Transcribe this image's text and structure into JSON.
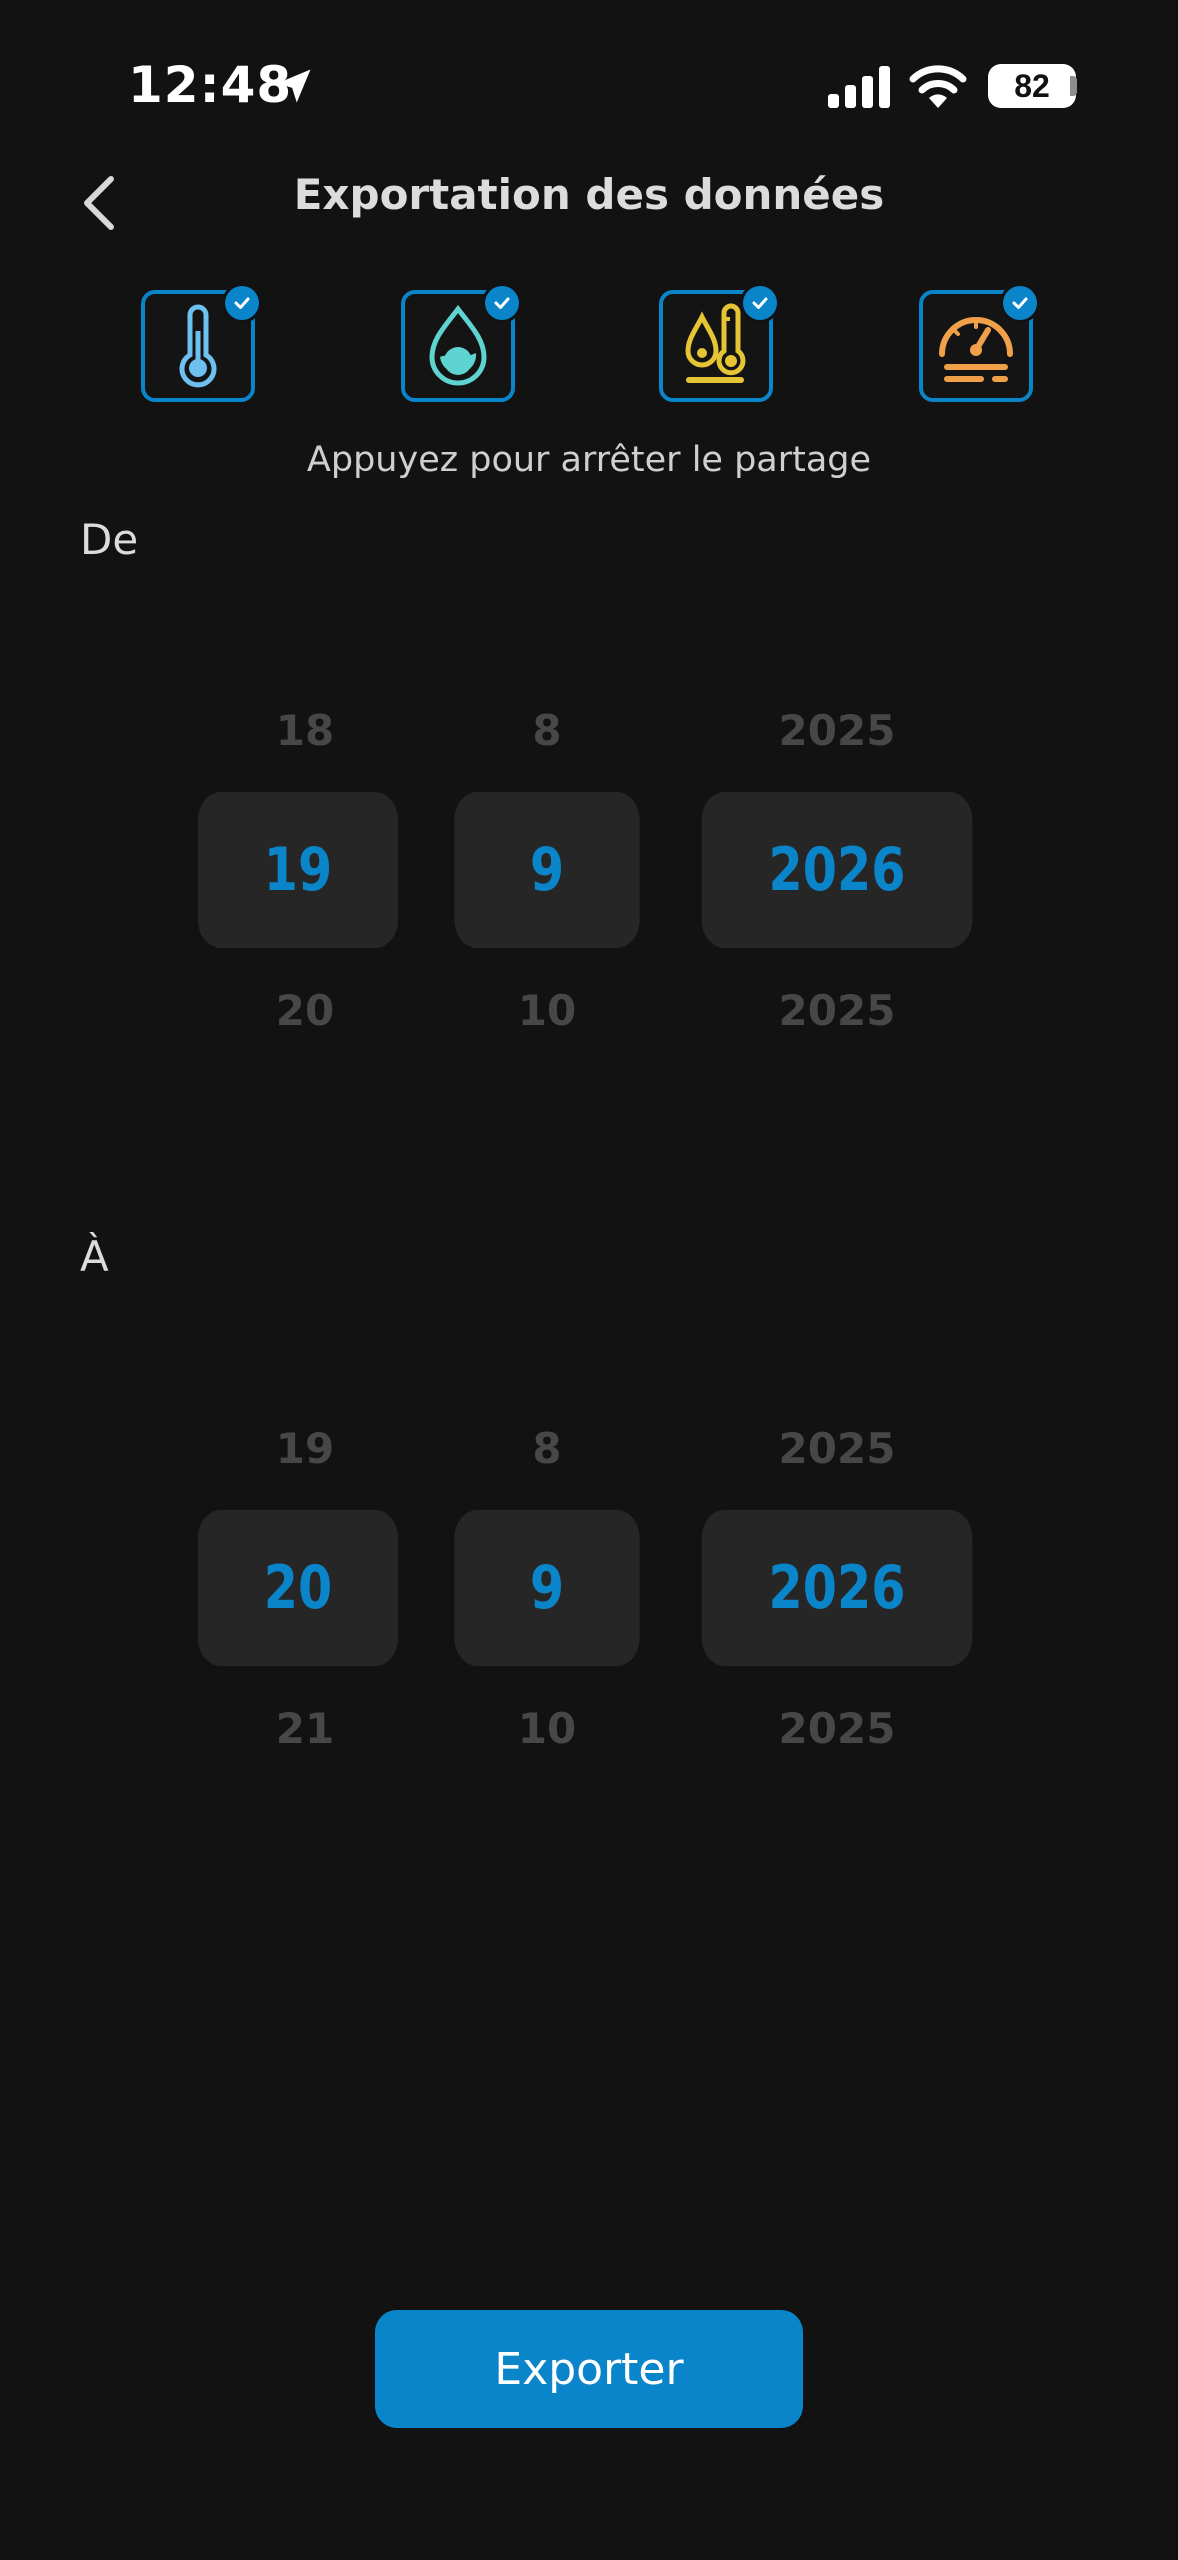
{
  "status_bar": {
    "time": "12:48",
    "battery": "82"
  },
  "header": {
    "title": "Exportation des données"
  },
  "categories": [
    {
      "icon": "thermometer-icon",
      "color": "#6ec0ef",
      "checked": true
    },
    {
      "icon": "water-drop-icon",
      "color": "#5fd3d0",
      "checked": true
    },
    {
      "icon": "dew-point-icon",
      "color": "#e6c534",
      "checked": true
    },
    {
      "icon": "pressure-gauge-icon",
      "color": "#f0a048",
      "checked": true
    }
  ],
  "hint": "Appuyez pour arrêter le partage",
  "from": {
    "label": "De",
    "day": {
      "prev": "18",
      "selected": "19",
      "next": "20"
    },
    "month": {
      "prev": "8",
      "selected": "9",
      "next": "10"
    },
    "year": {
      "prev": "2025",
      "selected": "2026",
      "next": "2025"
    }
  },
  "to": {
    "label": "À",
    "day": {
      "prev": "19",
      "selected": "20",
      "next": "21"
    },
    "month": {
      "prev": "8",
      "selected": "9",
      "next": "10"
    },
    "year": {
      "prev": "2025",
      "selected": "2026",
      "next": "2025"
    }
  },
  "export_button": {
    "label": "Exporter"
  },
  "colors": {
    "accent": "#0a85c9",
    "background": "#121212",
    "picker_selected_bg": "#262626"
  }
}
